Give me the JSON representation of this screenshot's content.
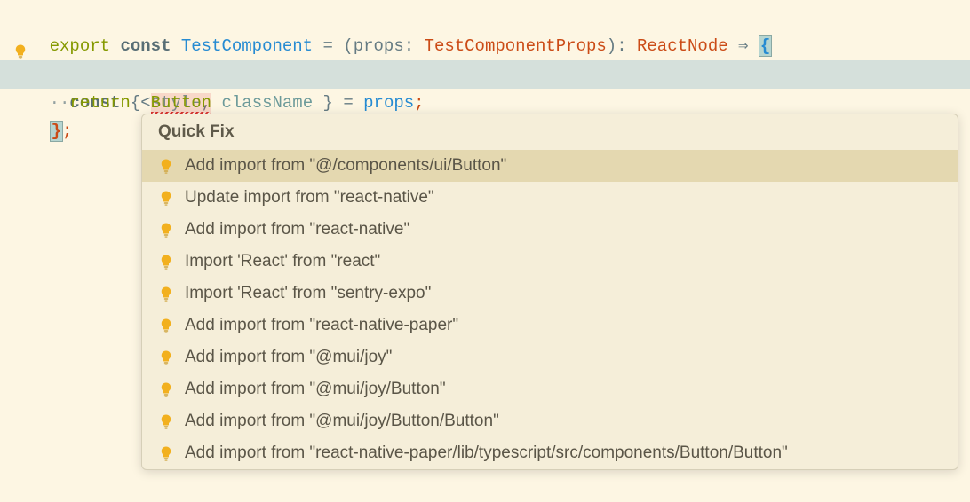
{
  "code": {
    "line1": {
      "export": "export ",
      "const": "const ",
      "name": "TestComponent",
      "eq": " = ",
      "lparen": "(",
      "argname": "props",
      "colon": ": ",
      "argtype": "TestComponentProps",
      "rparen": ")",
      "colon2": ": ",
      "rettype": "ReactNode",
      "arrow": " ⇒ ",
      "brace": "{"
    },
    "line2": {
      "indent": "  ",
      "const": "const ",
      "lbrace": "{ ",
      "p1": "style",
      "comma": ", ",
      "p2": "className",
      "rbrace": " }",
      "eq": " = ",
      "var": "props",
      "semi": ";"
    },
    "line3": {
      "dots": "··",
      "return": "return ",
      "lt": "<",
      "comp": "Button"
    },
    "line4": {
      "brace": "}",
      "semi": ";"
    }
  },
  "popup": {
    "title": "Quick Fix",
    "items": [
      "Add import from \"@/components/ui/Button\"",
      "Update import from \"react-native\"",
      "Add import from \"react-native\"",
      "Import 'React' from \"react\"",
      "Import 'React' from \"sentry-expo\"",
      "Add import from \"react-native-paper\"",
      "Add import from \"@mui/joy\"",
      "Add import from \"@mui/joy/Button\"",
      "Add import from \"@mui/joy/Button/Button\"",
      "Add import from \"react-native-paper/lib/typescript/src/components/Button/Button\""
    ],
    "selectedIndex": 0
  }
}
